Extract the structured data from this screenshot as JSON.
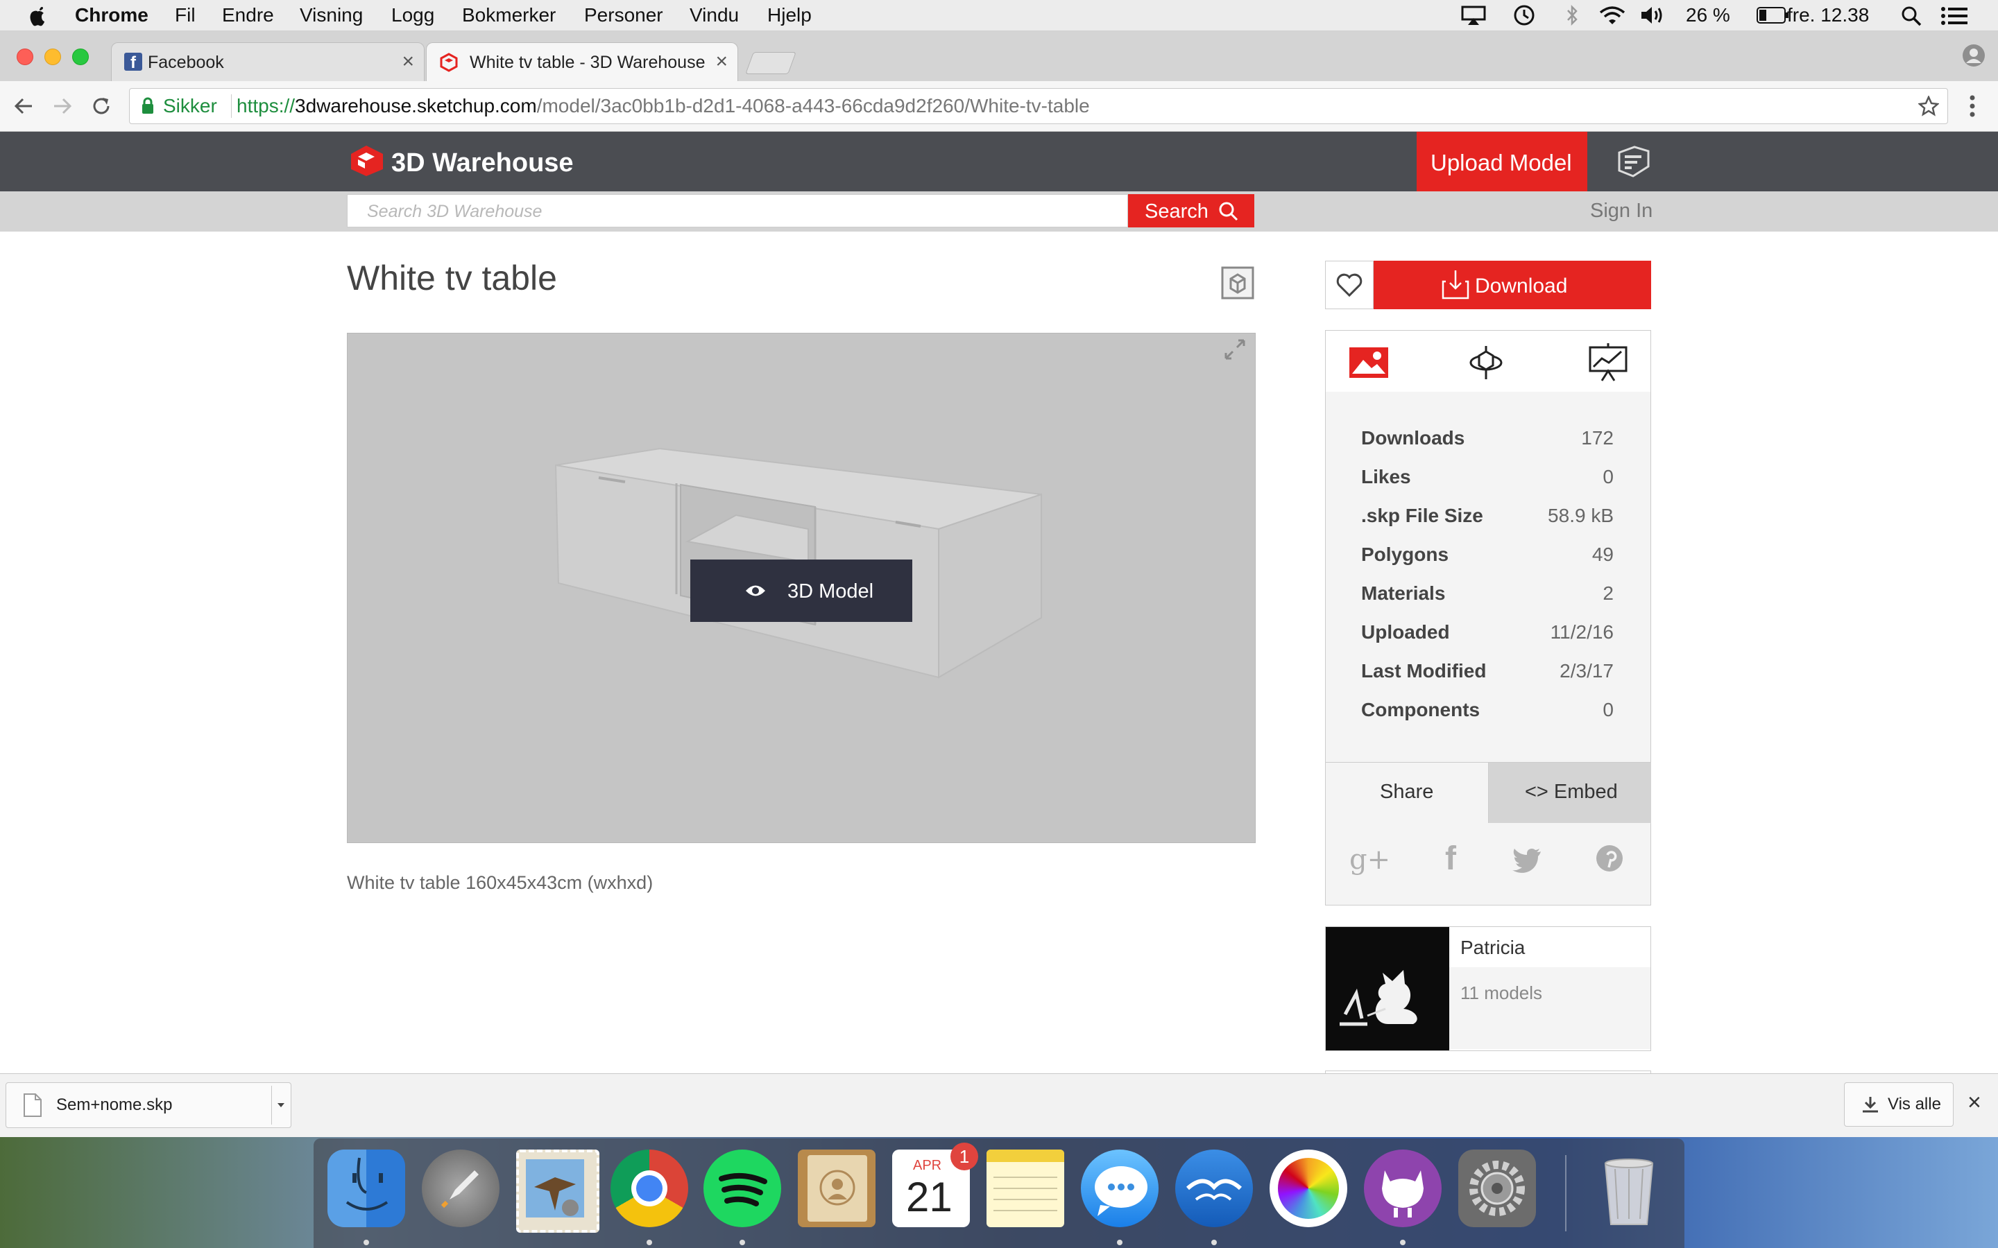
{
  "menubar": {
    "app": "Chrome",
    "items": [
      "Fil",
      "Endre",
      "Visning",
      "Logg",
      "Bokmerker",
      "Personer",
      "Vindu",
      "Hjelp"
    ],
    "battery": "26 %",
    "clock": "fre. 12.38"
  },
  "tabs": [
    {
      "title": "Facebook"
    },
    {
      "title": "White tv table - 3D Warehouse"
    }
  ],
  "toolbar": {
    "secure_label": "Sikker",
    "url_scheme": "https://",
    "url_host": "3dwarehouse.sketchup.com",
    "url_path": "/model/3ac0bb1b-d2d1-4068-a443-66cda9d2f260/White-tv-table"
  },
  "site": {
    "logo_text": "3D Warehouse",
    "upload_label": "Upload Model",
    "search_placeholder": "Search 3D Warehouse",
    "search_button": "Search",
    "sign_in": "Sign In"
  },
  "model": {
    "title": "White tv table",
    "viewer_button": "3D Model",
    "description": "White tv table 160x45x43cm (wxhxd)"
  },
  "sidebar": {
    "download_label": "Download",
    "stats": [
      {
        "label": "Downloads",
        "value": "172"
      },
      {
        "label": "Likes",
        "value": "0"
      },
      {
        "label": ".skp File Size",
        "value": "58.9 kB"
      },
      {
        "label": "Polygons",
        "value": "49"
      },
      {
        "label": "Materials",
        "value": "2"
      },
      {
        "label": "Uploaded",
        "value": "11/2/16"
      },
      {
        "label": "Last Modified",
        "value": "2/3/17"
      },
      {
        "label": "Components",
        "value": "0"
      }
    ],
    "share_tab": "Share",
    "embed_tab": "<> Embed",
    "author": {
      "name": "Patricia",
      "models": "11 models"
    }
  },
  "downloads_shelf": {
    "file": "Sem+nome.skp",
    "show_all": "Vis alle"
  },
  "dock": {
    "calendar_month": "APR",
    "calendar_day": "21",
    "calendar_badge": "1"
  },
  "colors": {
    "brand_red": "#e52421",
    "header_dark": "#4b4d52",
    "secure_green": "#1e8e3e"
  }
}
